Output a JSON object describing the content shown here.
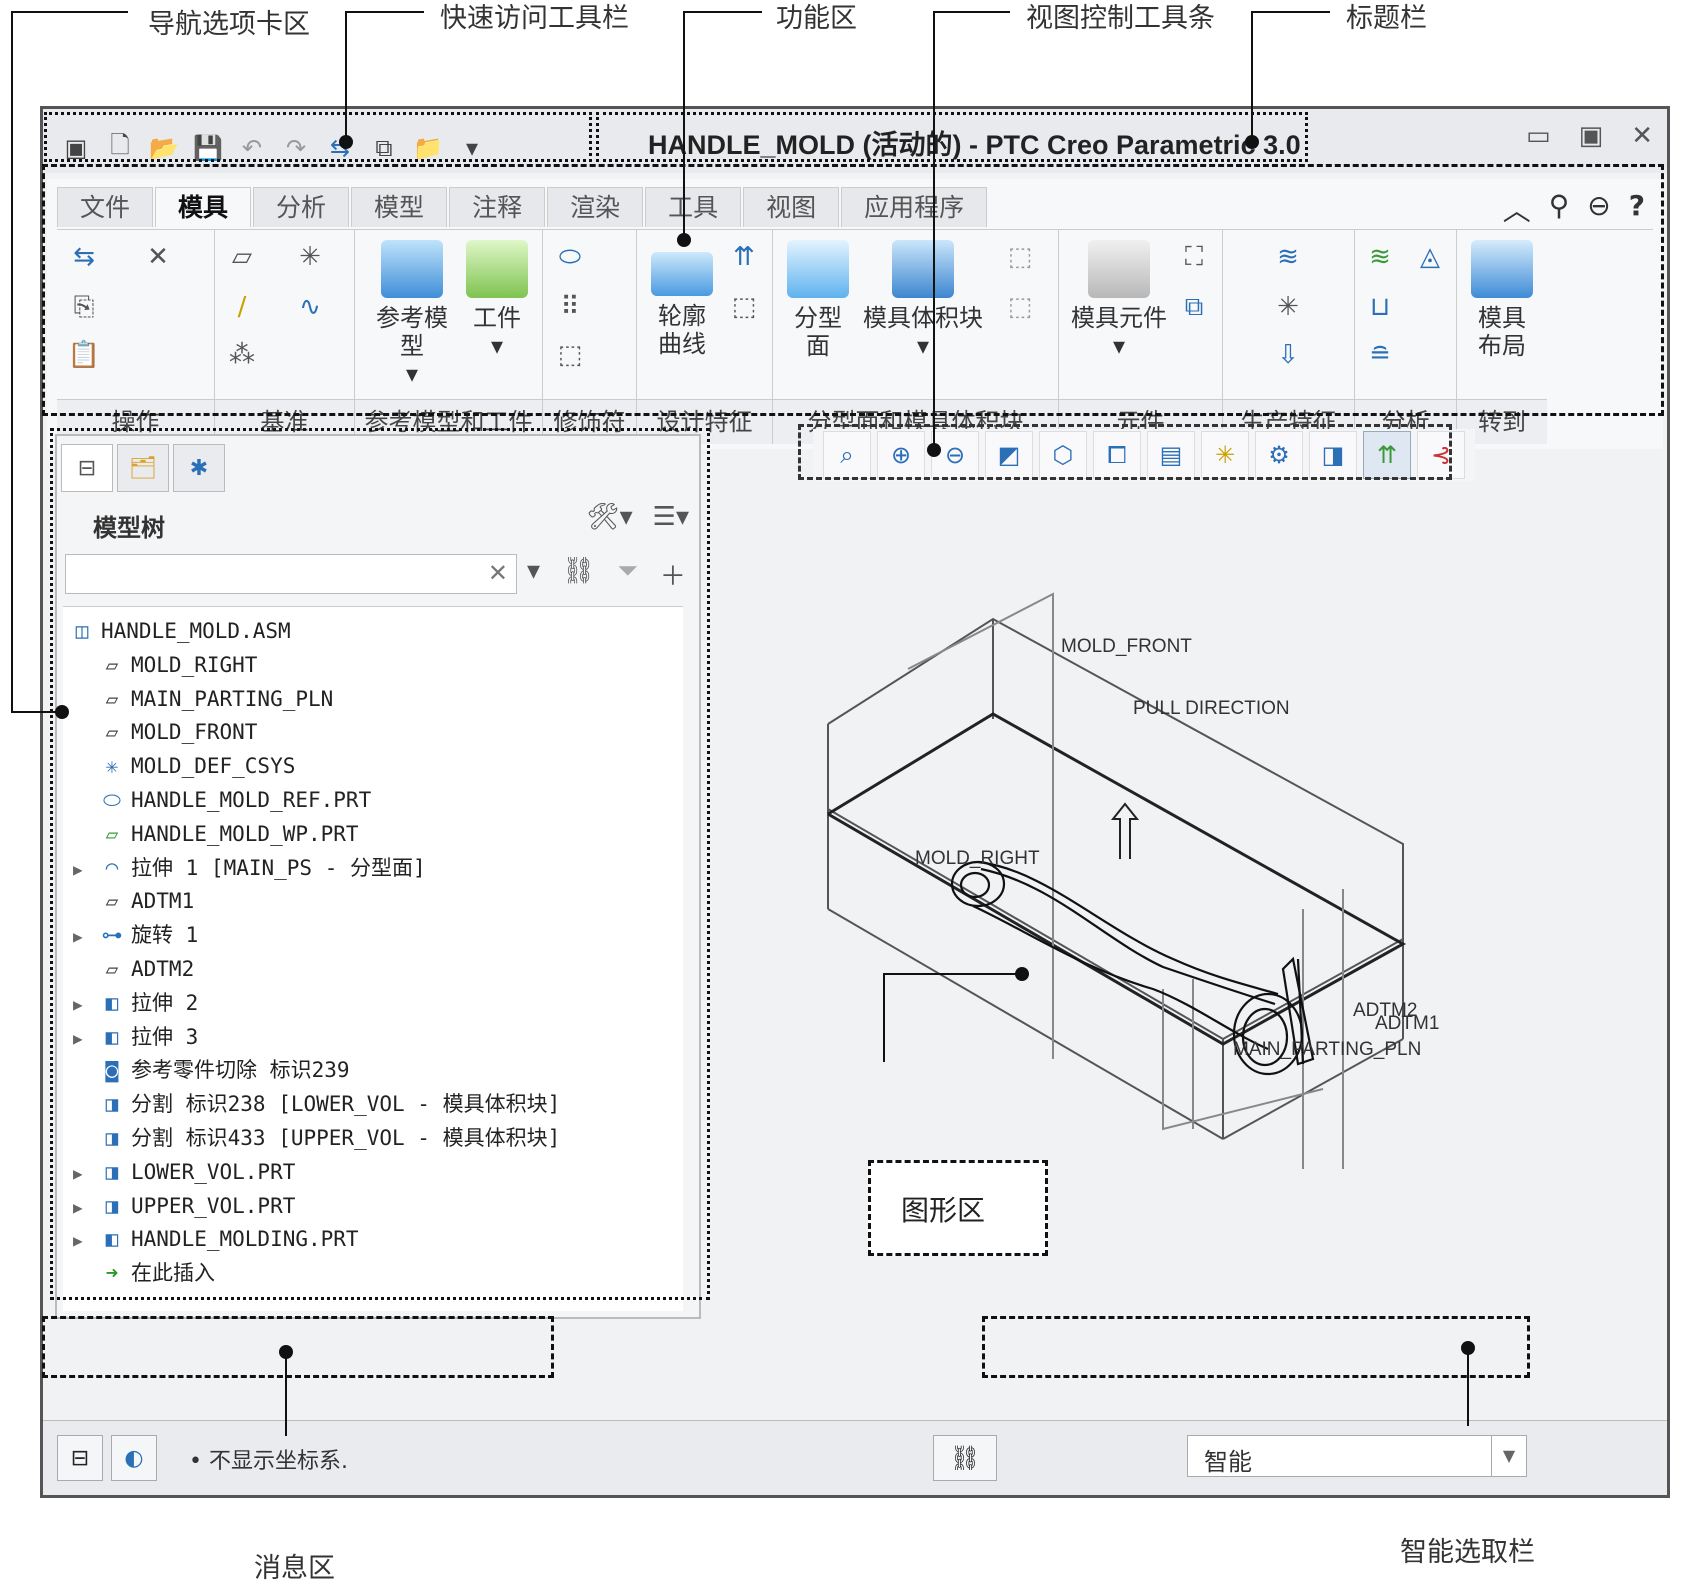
{
  "callouts": {
    "nav_tabs": "导航选项卡区",
    "quick_access": "快速访问工具栏",
    "ribbon": "功能区",
    "view_toolbar": "视图控制工具条",
    "title_bar": "标题栏",
    "graphics": "图形区",
    "message": "消息区",
    "smart_select": "智能选取栏"
  },
  "window": {
    "title": "HANDLE_MOLD (活动的) - PTC Creo Parametric 3.0"
  },
  "ribbon": {
    "tabs": [
      "文件",
      "模具",
      "分析",
      "模型",
      "注释",
      "渲染",
      "工具",
      "视图",
      "应用程序"
    ],
    "active_tab": "模具",
    "groups": {
      "operations": "操作",
      "datum": "基准",
      "ref_model": "参考模型和工件",
      "cosmetic": "修饰符",
      "design_feature": "设计特征",
      "parting": "分型面和模具体积块",
      "component": "元件",
      "production": "生产特征",
      "analysis": "分析",
      "goto": "转到"
    },
    "buttons": {
      "ref_model": "参考模型",
      "workpiece": "工件",
      "contour_curve_1": "轮廓",
      "contour_curve_2": "曲线",
      "parting_surface_1": "分型",
      "parting_surface_2": "面",
      "mold_volume": "模具体积块",
      "mold_component": "模具元件",
      "mold_layout_1": "模具",
      "mold_layout_2": "布局"
    }
  },
  "nav": {
    "header": "模型树",
    "tree": [
      {
        "label": "HANDLE_MOLD.ASM",
        "icon": "assembly-icon",
        "indent": 0,
        "expand": false
      },
      {
        "label": "MOLD_RIGHT",
        "icon": "datum-plane-icon",
        "indent": 1,
        "expand": false
      },
      {
        "label": "MAIN_PARTING_PLN",
        "icon": "datum-plane-icon",
        "indent": 1,
        "expand": false
      },
      {
        "label": "MOLD_FRONT",
        "icon": "datum-plane-icon",
        "indent": 1,
        "expand": false
      },
      {
        "label": "MOLD_DEF_CSYS",
        "icon": "csys-icon",
        "indent": 1,
        "expand": false
      },
      {
        "label": "HANDLE_MOLD_REF.PRT",
        "icon": "ref-part-icon",
        "indent": 1,
        "expand": false
      },
      {
        "label": "HANDLE_MOLD_WP.PRT",
        "icon": "workpiece-icon",
        "indent": 1,
        "expand": false
      },
      {
        "label": "拉伸 1 [MAIN_PS - 分型面]",
        "icon": "surface-icon",
        "indent": 1,
        "expand": true
      },
      {
        "label": "ADTM1",
        "icon": "datum-plane-icon",
        "indent": 1,
        "expand": false
      },
      {
        "label": "旋转 1",
        "icon": "revolve-icon",
        "indent": 1,
        "expand": true
      },
      {
        "label": "ADTM2",
        "icon": "datum-plane-icon",
        "indent": 1,
        "expand": false
      },
      {
        "label": "拉伸 2",
        "icon": "extrude-icon",
        "indent": 1,
        "expand": true
      },
      {
        "label": "拉伸 3",
        "icon": "extrude-icon",
        "indent": 1,
        "expand": true
      },
      {
        "label": "参考零件切除 标识239",
        "icon": "cutout-icon",
        "indent": 1,
        "expand": false
      },
      {
        "label": "分割 标识238 [LOWER_VOL - 模具体积块]",
        "icon": "split-icon",
        "indent": 1,
        "expand": false
      },
      {
        "label": "分割 标识433 [UPPER_VOL - 模具体积块]",
        "icon": "split-icon",
        "indent": 1,
        "expand": false
      },
      {
        "label": "LOWER_VOL.PRT",
        "icon": "volume-part-icon",
        "indent": 1,
        "expand": true
      },
      {
        "label": "UPPER_VOL.PRT",
        "icon": "volume-part-icon",
        "indent": 1,
        "expand": true
      },
      {
        "label": "HANDLE_MOLDING.PRT",
        "icon": "molding-icon",
        "indent": 1,
        "expand": true
      },
      {
        "label": "在此插入",
        "icon": "insert-here-icon",
        "indent": 1,
        "expand": false
      }
    ]
  },
  "graphics": {
    "labels": {
      "mold_front": "MOLD_FRONT",
      "pull_direction": "PULL DIRECTION",
      "mold_right": "MOLD_RIGHT",
      "adtm2": "ADTM2",
      "adtm1": "ADTM1",
      "main_parting": "MAIN_PARTING_PLN"
    }
  },
  "status": {
    "message": "• 不显示坐标系.",
    "smart_select": "智能"
  }
}
